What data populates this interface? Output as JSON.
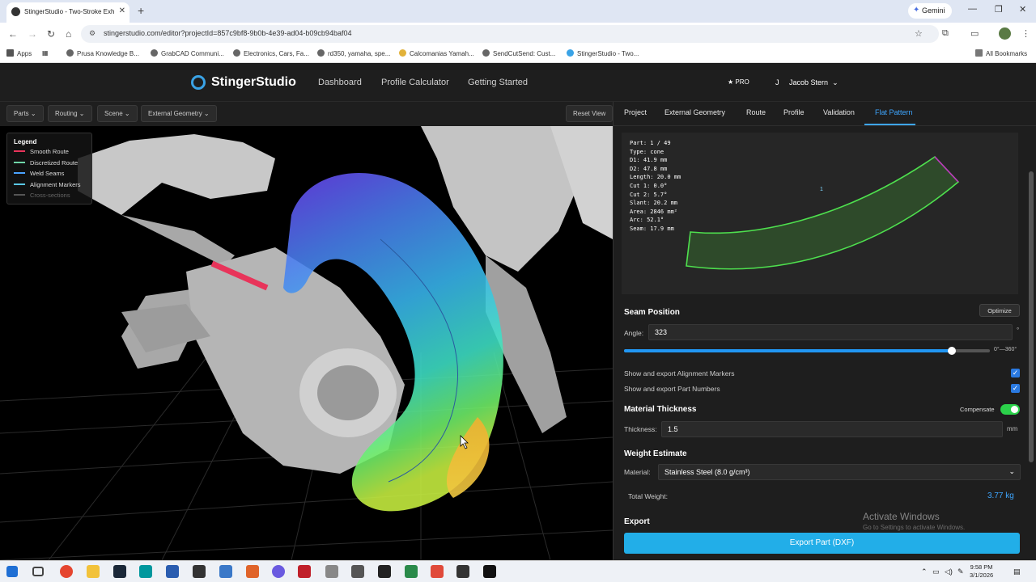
{
  "browser": {
    "tab_title": "StingerStudio - Two-Stroke Exh",
    "gemini_label": "Gemini",
    "url": "stingerstudio.com/editor?projectId=857c9bf8-9b0b-4e39-ad04-b09cb94baf04",
    "bookmarks": [
      "Apps",
      "Prusa Knowledge B...",
      "GrabCAD Communi...",
      "Electronics, Cars, Fa...",
      "rd350, yamaha, spe...",
      "Calcomanias Yamah...",
      "SendCutSend: Cust...",
      "StingerStudio - Two..."
    ],
    "all_bookmarks": "All Bookmarks"
  },
  "app": {
    "logo": "StingerStudio",
    "nav": [
      "Dashboard",
      "Profile Calculator",
      "Getting Started"
    ],
    "pro_badge": "★ PRO",
    "user_initial": "J",
    "user_name": "Jacob Stern"
  },
  "toolbar": {
    "parts": "Parts ⌄",
    "routing": "Routing ⌄",
    "scene": "Scene ⌄",
    "external_geometry": "External Geometry ⌄",
    "reset_view": "Reset View"
  },
  "legend": {
    "title": "Legend",
    "items": [
      {
        "label": "Smooth Route",
        "color": "#e8345a"
      },
      {
        "label": "Discretized Route",
        "color": "#6fd6a8"
      },
      {
        "label": "Weld Seams",
        "color": "#4aa3ff"
      },
      {
        "label": "Alignment Markers",
        "color": "#5ac8e6"
      },
      {
        "label": "Cross-sections",
        "color": "#555555"
      }
    ]
  },
  "panel": {
    "tabs": [
      "Project",
      "External Geometry",
      "Route",
      "Profile",
      "Validation",
      "Flat Pattern"
    ],
    "active_tab": "Flat Pattern",
    "part_info": [
      "Part: 1 / 49",
      "Type: cone",
      "D1: 41.9 mm",
      "D2: 47.8 mm",
      "Length: 20.0 mm",
      "Cut 1: 0.0°",
      "Cut 2: 5.7°",
      "Slant: 20.2 mm",
      "Area: 2846 mm²",
      "Arc: 52.1°",
      "Seam: 17.9 mm"
    ],
    "preview_marker": "1",
    "seam_position": {
      "title": "Seam Position",
      "optimize": "Optimize",
      "angle_label": "Angle:",
      "angle_value": "323",
      "angle_unit": "°",
      "range_label": "0°—360°",
      "slider_fraction": 0.897
    },
    "show_alignment": "Show and export Alignment Markers",
    "show_part_numbers": "Show and export Part Numbers",
    "material_thickness": {
      "title": "Material Thickness",
      "compensate": "Compensate",
      "thickness_label": "Thickness:",
      "thickness_value": "1.5",
      "unit": "mm"
    },
    "weight": {
      "title": "Weight Estimate",
      "material_label": "Material:",
      "material_value": "Stainless Steel (8.0 g/cm³)",
      "total_label": "Total Weight:",
      "total_value": "3.77 kg"
    },
    "export": {
      "title": "Export",
      "button": "Export Part (DXF)"
    }
  },
  "watermark": {
    "line1": "Activate Windows",
    "line2": "Go to Settings to activate Windows."
  },
  "taskbar": {
    "time": "9:58 PM",
    "date": "3/1/2026"
  }
}
